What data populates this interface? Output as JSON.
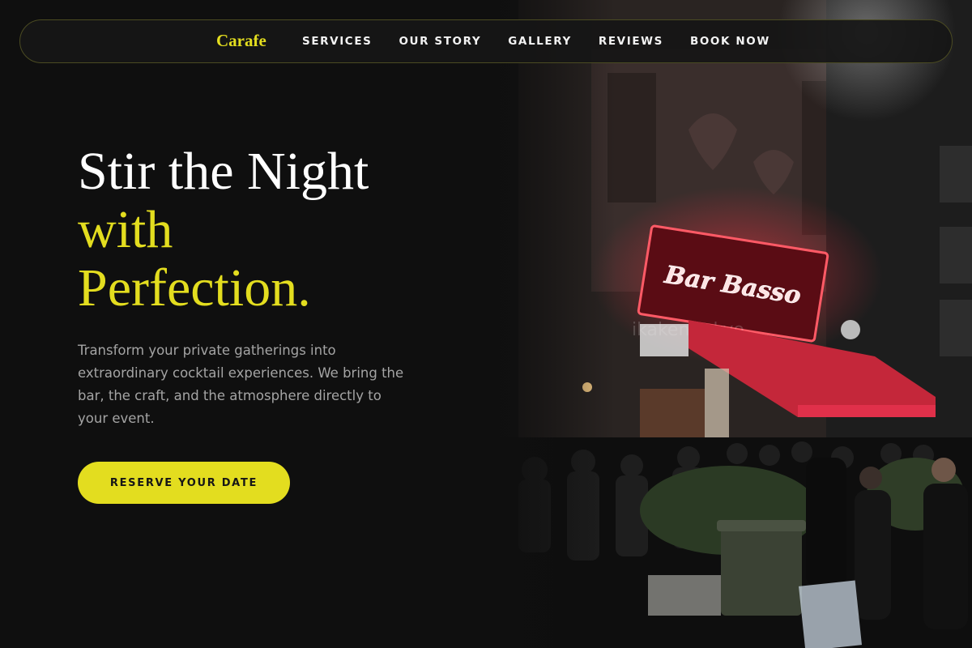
{
  "brand": {
    "name": "Carafe",
    "accent_color": "#e3dd1f"
  },
  "nav": {
    "items": [
      {
        "label": "SERVICES"
      },
      {
        "label": "OUR STORY"
      },
      {
        "label": "GALLERY"
      },
      {
        "label": "REVIEWS"
      },
      {
        "label": "BOOK NOW"
      }
    ]
  },
  "hero": {
    "headline_line1": "Stir the Night",
    "headline_line2": "with",
    "headline_line3": "Perfection.",
    "description": "Transform your private gatherings into extraordinary cocktail experiences. We bring the bar, the craft, and the atmosphere directly to your event.",
    "cta_label": "RESERVE YOUR DATE"
  },
  "photo": {
    "sign_text": "Bar Basso",
    "watermark": "ikaken.tokyo",
    "description_icon": "night-bar-photo"
  }
}
